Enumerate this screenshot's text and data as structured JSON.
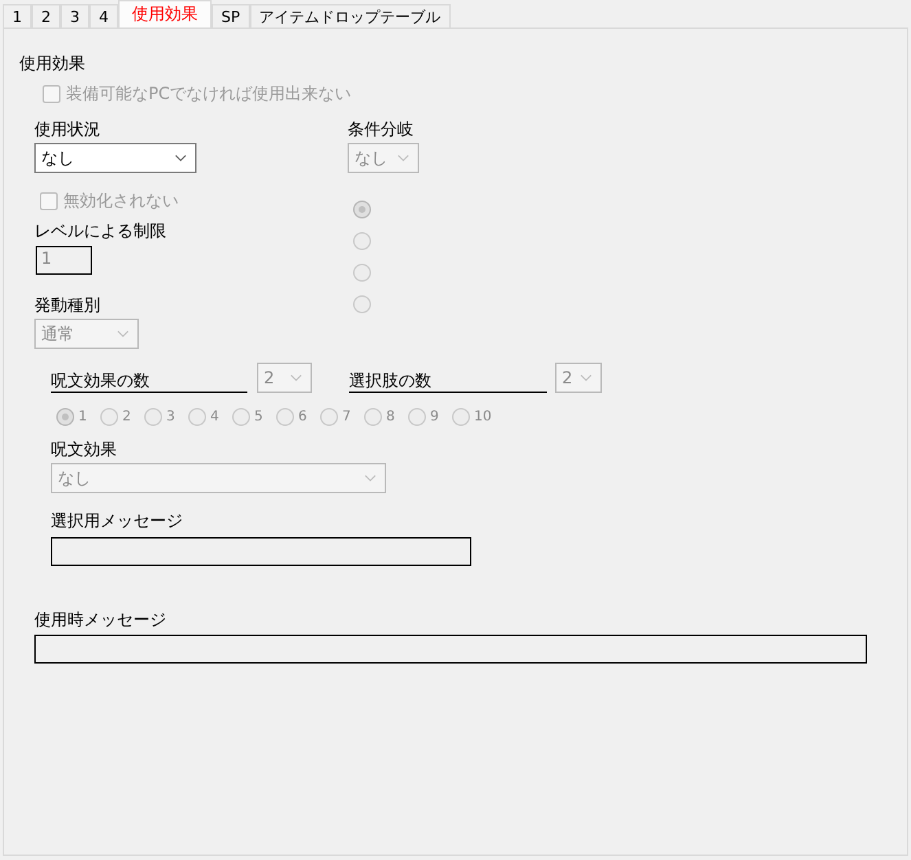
{
  "tabs": [
    {
      "label": "1",
      "selected": false
    },
    {
      "label": "2",
      "selected": false
    },
    {
      "label": "3",
      "selected": false
    },
    {
      "label": "4",
      "selected": false
    },
    {
      "label": "使用効果",
      "selected": true
    },
    {
      "label": "SP",
      "selected": false
    },
    {
      "label": "アイテムドロップテーブル",
      "selected": false
    }
  ],
  "panel": {
    "title": "使用効果",
    "equip_only": {
      "label": "装備可能なPCでなければ使用出来ない",
      "checked": false,
      "disabled": true
    },
    "usage": {
      "label": "使用状況",
      "value": "なし",
      "disabled": false
    },
    "no_nullify": {
      "label": "無効化されない",
      "checked": false,
      "disabled": true
    },
    "level_limit": {
      "label": "レベルによる制限",
      "value": "1"
    },
    "trigger_type": {
      "label": "発動種別",
      "value": "通常",
      "disabled": true
    },
    "branch": {
      "label": "条件分岐",
      "value": "なし",
      "disabled": true
    },
    "branch_options": {
      "disabled": true,
      "items": [
        {
          "selected": true
        },
        {
          "selected": false
        },
        {
          "selected": false
        },
        {
          "selected": false
        }
      ]
    },
    "spell_count": {
      "label": "呪文効果の数",
      "value": "2",
      "disabled": true
    },
    "choice_count": {
      "label": "選択肢の数",
      "value": "2",
      "disabled": true
    },
    "spell_slots": {
      "disabled": true,
      "items": [
        {
          "label": "1",
          "selected": true
        },
        {
          "label": "2",
          "selected": false
        },
        {
          "label": "3",
          "selected": false
        },
        {
          "label": "4",
          "selected": false
        },
        {
          "label": "5",
          "selected": false
        },
        {
          "label": "6",
          "selected": false
        },
        {
          "label": "7",
          "selected": false
        },
        {
          "label": "8",
          "selected": false
        },
        {
          "label": "9",
          "selected": false
        },
        {
          "label": "10",
          "selected": false
        }
      ]
    },
    "spell_effect": {
      "label": "呪文効果",
      "value": "なし",
      "disabled": true
    },
    "choice_message": {
      "label": "選択用メッセージ"
    },
    "use_message": {
      "label": "使用時メッセージ"
    }
  }
}
